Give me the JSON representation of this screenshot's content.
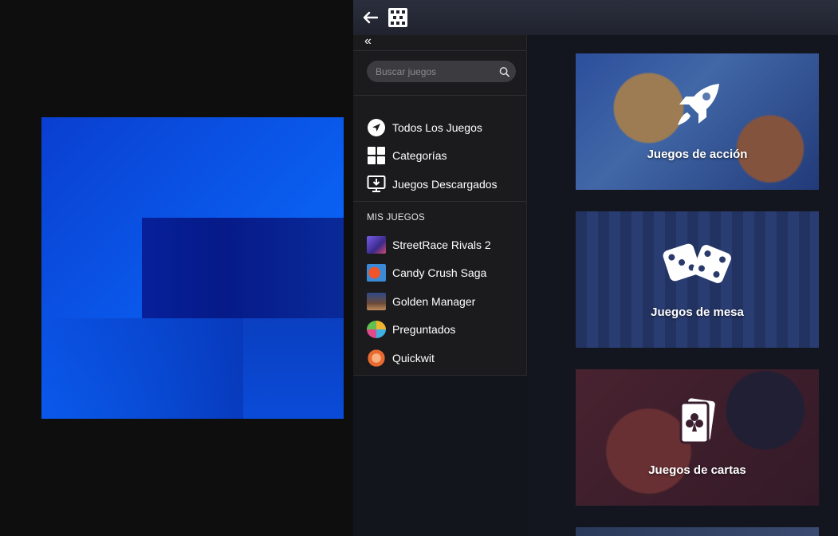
{
  "topbar": {
    "back_icon": "arrow-left-icon",
    "logo_icon": "dice-logo-icon"
  },
  "sidebar": {
    "collapse_glyph": "«",
    "search": {
      "placeholder": "Buscar juegos",
      "value": ""
    },
    "nav": [
      {
        "label": "Todos Los Juegos",
        "icon": "compass-icon"
      },
      {
        "label": "Categorías",
        "icon": "grid-icon"
      },
      {
        "label": "Juegos Descargados",
        "icon": "download-monitor-icon"
      }
    ],
    "mis_juegos_title": "MIS JUEGOS",
    "games": [
      {
        "label": "StreetRace Rivals 2",
        "color": "#6a4ad8"
      },
      {
        "label": "Candy Crush Saga",
        "color": "#e2572c"
      },
      {
        "label": "Golden Manager",
        "color": "#3a6fb0"
      },
      {
        "label": "Preguntados",
        "color": "#f0b430"
      },
      {
        "label": "Quickwit",
        "color": "#f08040"
      }
    ]
  },
  "cards": [
    {
      "label": "Juegos de acción",
      "icon": "rocket-icon"
    },
    {
      "label": "Juegos de mesa",
      "icon": "dice-icon"
    },
    {
      "label": "Juegos de cartas",
      "icon": "card-club-icon"
    }
  ],
  "colors": {
    "splash_blue": "#0a5ef0",
    "app_bg": "#14161f",
    "sidebar_bg": "#1b1b1d"
  }
}
